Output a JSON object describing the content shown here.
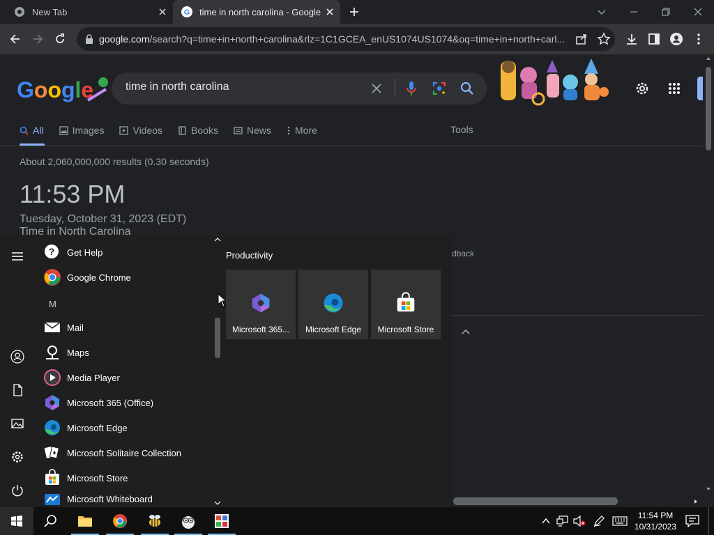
{
  "browser": {
    "tabs": [
      {
        "title": "New Tab"
      },
      {
        "title": "time in north carolina - Google Search"
      }
    ],
    "url_host": "google.com",
    "url_path": "/search?q=time+in+north+carolina&rlz=1C1GCEA_enUS1074US1074&oq=time+in+north+carl..."
  },
  "search": {
    "query": "time in north carolina",
    "nav_tabs": [
      "All",
      "Images",
      "Videos",
      "Books",
      "News",
      "More"
    ],
    "tools_label": "Tools",
    "results_count": "About 2,060,000,000 results (0.30 seconds)",
    "time": "11:53 PM",
    "date": "Tuesday, October 31, 2023 (EDT)",
    "timezone_label": "Time in North Carolina",
    "feedback_partial": "dback"
  },
  "start_menu": {
    "apps": [
      {
        "label": "Get Help",
        "icon": "help-icon"
      },
      {
        "label": "Google Chrome",
        "icon": "chrome-icon"
      },
      {
        "label": "M",
        "icon": ""
      },
      {
        "label": "Mail",
        "icon": "mail-icon"
      },
      {
        "label": "Maps",
        "icon": "maps-icon"
      },
      {
        "label": "Media Player",
        "icon": "media-player-icon"
      },
      {
        "label": "Microsoft 365 (Office)",
        "icon": "m365-icon"
      },
      {
        "label": "Microsoft Edge",
        "icon": "edge-icon"
      },
      {
        "label": "Microsoft Solitaire Collection",
        "icon": "solitaire-icon"
      },
      {
        "label": "Microsoft Store",
        "icon": "store-icon"
      },
      {
        "label": "Microsoft Whiteboard",
        "icon": "whiteboard-icon"
      }
    ],
    "group_title": "Productivity",
    "tiles": [
      {
        "label": "Microsoft 365...",
        "icon": "m365-icon"
      },
      {
        "label": "Microsoft Edge",
        "icon": "edge-icon"
      },
      {
        "label": "Microsoft Store",
        "icon": "store-icon"
      }
    ]
  },
  "taskbar": {
    "time": "11:54 PM",
    "date": "10/31/2023"
  },
  "colors": {
    "accent": "#8ab4f8",
    "page_bg": "#202124",
    "start_bg": "#1f1f1f"
  }
}
